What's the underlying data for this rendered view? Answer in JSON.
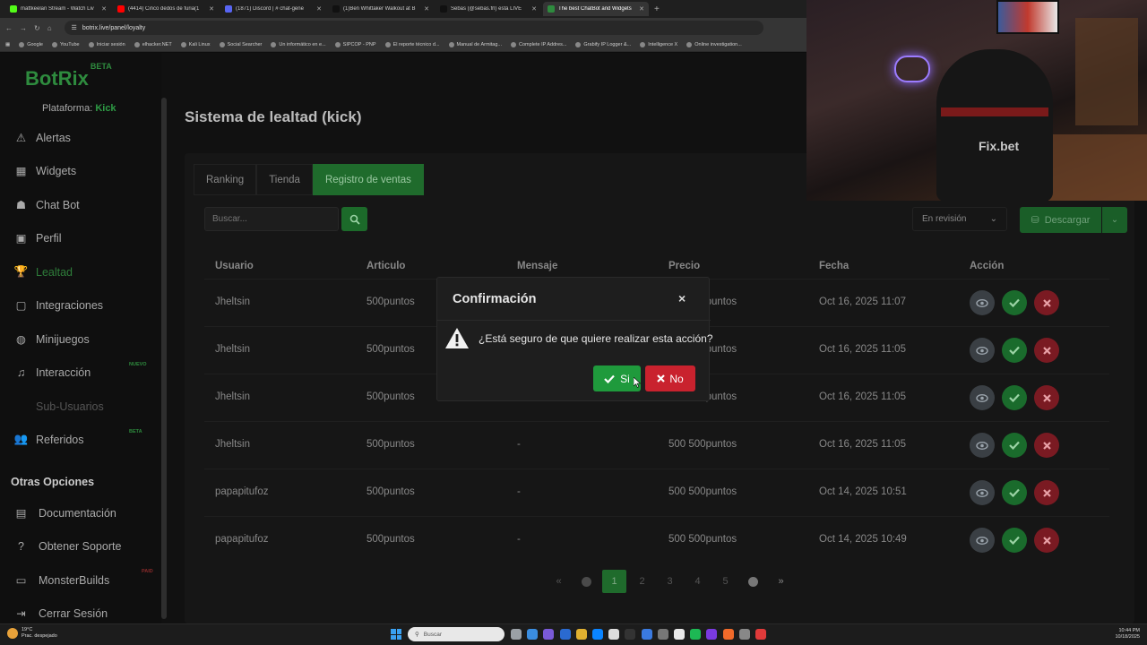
{
  "browser": {
    "tabs": [
      {
        "label": "mattkeelan Stream - Watch Liv",
        "color": "#53fc18",
        "active": false
      },
      {
        "label": "(4414) Cinco dedos de furia(1",
        "color": "#ff0000",
        "active": false
      },
      {
        "label": "(1871) Discord | # chat-gene",
        "color": "#5865f2",
        "active": false
      },
      {
        "label": "(1)Ben Whittaker Walkout at B",
        "color": "#111111",
        "active": false
      },
      {
        "label": "Sebas (@sebas.frl) está LIVE",
        "color": "#111111",
        "active": false
      },
      {
        "label": "The best ChatBot and Widgets",
        "color": "#2e8b3e",
        "active": true
      }
    ],
    "new_tab": "+",
    "url": "botrix.live/panel/loyalty",
    "bookmarks": [
      "Google",
      "YouTube",
      "Iniciar sesión",
      "elhacker.NET",
      "Kali Linux",
      "Social Searcher",
      "Un informático en e...",
      "SIPCOP - PNP",
      "El reporte técnico d...",
      "Manual de Armitag...",
      "Complete IP Addres...",
      "Grabify IP Logger &...",
      "Intelligence X",
      "Online investigation..."
    ]
  },
  "sidebar": {
    "logo": "BotRix",
    "logo_badge": "BETA",
    "platform_label": "Plataforma:",
    "platform_value": "Kick",
    "items": [
      {
        "label": "Alertas",
        "icon": "alert-triangle-icon"
      },
      {
        "label": "Widgets",
        "icon": "grid-icon"
      },
      {
        "label": "Chat Bot",
        "icon": "robot-icon"
      },
      {
        "label": "Perfil",
        "icon": "id-card-icon"
      },
      {
        "label": "Lealtad",
        "icon": "trophy-icon"
      },
      {
        "label": "Integraciones",
        "icon": "square-icon"
      },
      {
        "label": "Minijuegos",
        "icon": "gamepad-icon"
      },
      {
        "label": "Interacción",
        "icon": "music-note-icon",
        "badge": "NUEVO"
      },
      {
        "label": "Sub-Usuarios",
        "icon": "none"
      },
      {
        "label": "Referidos",
        "icon": "users-icon",
        "badge": "BETA"
      }
    ],
    "other_title": "Otras Opciones",
    "other_items": [
      {
        "label": "Documentación",
        "icon": "book-icon"
      },
      {
        "label": "Obtener Soporte",
        "icon": "help-icon"
      },
      {
        "label": "MonsterBuilds",
        "icon": "monitor-icon",
        "badge": "PAID"
      },
      {
        "label": "Cerrar Sesión",
        "icon": "logout-icon"
      }
    ]
  },
  "main": {
    "title": "Sistema de lealtad (kick)",
    "tabs": [
      "Ranking",
      "Tienda",
      "Registro de ventas"
    ],
    "active_tab": "Registro de ventas",
    "search_placeholder": "Buscar...",
    "status_filter": "En revisión",
    "download_label": "Descargar",
    "columns": [
      "Usuario",
      "Articulo",
      "Mensaje",
      "Precio",
      "Fecha",
      "Acción"
    ],
    "rows": [
      {
        "usuario": "Jheltsin",
        "articulo": "500puntos",
        "mensaje": "-",
        "precio": "500 500puntos",
        "fecha": "Oct 16, 2025 11:07"
      },
      {
        "usuario": "Jheltsin",
        "articulo": "500puntos",
        "mensaje": "-",
        "precio": "500 500puntos",
        "fecha": "Oct 16, 2025 11:05"
      },
      {
        "usuario": "Jheltsin",
        "articulo": "500puntos",
        "mensaje": "-",
        "precio": "500 500puntos",
        "fecha": "Oct 16, 2025 11:05"
      },
      {
        "usuario": "Jheltsin",
        "articulo": "500puntos",
        "mensaje": "-",
        "precio": "500 500puntos",
        "fecha": "Oct 16, 2025 11:05"
      },
      {
        "usuario": "papapitufoz",
        "articulo": "500puntos",
        "mensaje": "-",
        "precio": "500 500puntos",
        "fecha": "Oct 14, 2025 10:51"
      },
      {
        "usuario": "papapitufoz",
        "articulo": "500puntos",
        "mensaje": "-",
        "precio": "500 500puntos",
        "fecha": "Oct 14, 2025 10:49"
      }
    ],
    "pagination": {
      "first": "«",
      "pages": [
        "1",
        "2",
        "3",
        "4",
        "5"
      ],
      "current": "1",
      "last": "»"
    }
  },
  "modal": {
    "title": "Confirmación",
    "close": "×",
    "message": "¿Está seguro de que quiere realizar esta acción?",
    "yes_label": "Si",
    "no_label": "No"
  },
  "webcam": {
    "jersey_text": "Fix.bet"
  },
  "taskbar": {
    "weather_temp": "19°C",
    "weather_desc": "Prac. despejado",
    "search_placeholder": "Buscar",
    "time": "10:44 PM",
    "date": "10/18/2025"
  },
  "colors": {
    "brand": "#2e8b3e",
    "confirm": "#1f9a3c",
    "danger": "#c9222e"
  }
}
